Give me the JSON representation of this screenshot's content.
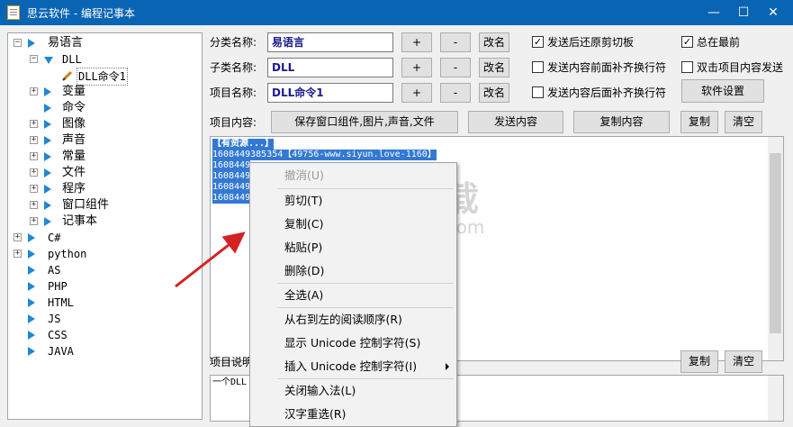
{
  "window": {
    "title": "思云软件 - 编程记事本",
    "minimize": "—",
    "maximize": "☐",
    "close": "✕"
  },
  "tree": {
    "items": [
      {
        "label": "易语言",
        "level": 0,
        "expanded": true
      },
      {
        "label": "DLL",
        "level": 1,
        "expanded": true
      },
      {
        "label": "DLL命令1",
        "level": 2,
        "selected": true
      },
      {
        "label": "变量",
        "level": 1
      },
      {
        "label": "命令",
        "level": 1
      },
      {
        "label": "图像",
        "level": 1
      },
      {
        "label": "声音",
        "level": 1
      },
      {
        "label": "常量",
        "level": 1
      },
      {
        "label": "文件",
        "level": 1
      },
      {
        "label": "程序",
        "level": 1
      },
      {
        "label": "窗口组件",
        "level": 1
      },
      {
        "label": "记事本",
        "level": 1
      },
      {
        "label": "C#",
        "level": 0
      },
      {
        "label": "python",
        "level": 0
      },
      {
        "label": "AS",
        "level": 0
      },
      {
        "label": "PHP",
        "level": 0
      },
      {
        "label": "HTML",
        "level": 0
      },
      {
        "label": "JS",
        "level": 0
      },
      {
        "label": "CSS",
        "level": 0
      },
      {
        "label": "JAVA",
        "level": 0
      }
    ]
  },
  "form": {
    "category_label": "分类名称:",
    "category_value": "易语言",
    "subcategory_label": "子类名称:",
    "subcategory_value": "DLL",
    "item_label": "项目名称:",
    "item_value": "DLL命令1",
    "plus": "+",
    "minus": "-",
    "rename": "改名",
    "content_label": "项目内容:",
    "save_window_btn": "保存窗口组件,图片,声音,文件",
    "send_content_btn": "发送内容",
    "copy_content_btn": "复制内容",
    "copy_btn": "复制",
    "clear_btn": "清空",
    "desc_label": "项目说明",
    "desc_copy_btn": "复制",
    "desc_clear_btn": "清空",
    "settings_btn": "软件设置"
  },
  "options": {
    "restore_clipboard": {
      "label": "发送后还原剪切板",
      "checked": true
    },
    "top_most": {
      "label": "总在最前",
      "checked": true
    },
    "prefix_newline": {
      "label": "发送内容前面补齐换行符",
      "checked": false
    },
    "dblclick_send": {
      "label": "双击项目内容发送",
      "checked": false
    },
    "suffix_newline": {
      "label": "发送内容后面补齐换行符",
      "checked": false
    }
  },
  "content": {
    "lines": [
      "【有资源...】",
      "1608449385354【49756-www.siyun.love-1160】",
      "1608449",
      "1608449",
      "1608449",
      "1608449"
    ],
    "desc_text": "一个DLL"
  },
  "context_menu": {
    "items": [
      {
        "label": "撤消(U)",
        "disabled": true
      },
      {
        "label": "剪切(T)"
      },
      {
        "label": "复制(C)"
      },
      {
        "label": "粘贴(P)"
      },
      {
        "label": "删除(D)"
      },
      {
        "label": "全选(A)"
      },
      {
        "label": "从右到左的阅读顺序(R)"
      },
      {
        "label": "显示 Unicode 控制字符(S)"
      },
      {
        "label": "插入 Unicode 控制字符(I)",
        "submenu": true
      },
      {
        "label": "关闭输入法(L)"
      },
      {
        "label": "汉字重选(R)"
      }
    ]
  },
  "watermark": {
    "text": "安下载",
    "url": "anxz.com"
  },
  "colors": {
    "titlebar": "#0a64b4",
    "selection": "#3379d3",
    "tree_triangle": "#1e88d4",
    "field_text": "#1a1a8c",
    "arrow": "#d42222"
  }
}
